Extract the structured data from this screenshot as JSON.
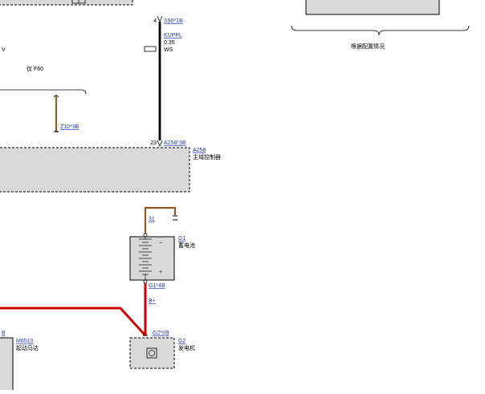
{
  "colors": {
    "wire_black": "#000000",
    "wire_red": "#cc0000",
    "wire_brown": "#8b5a2b",
    "box_fill": "#d9d9d9",
    "link": "#1f3fb0"
  },
  "top": {
    "pin_number": "4",
    "connector": "S50*1B",
    "wire_id": "KUPPL",
    "wire_gauge": "0.35",
    "wire_color": "WS",
    "left_edge_letter": "V",
    "variant_note": "仅 F60",
    "left_connector": "Z10*3B"
  },
  "right_box": {
    "caption": "根据配置情况"
  },
  "a258": {
    "pin_number": "23",
    "connector": "A258*3B",
    "id": "A258",
    "name": "主域控制器"
  },
  "battery": {
    "ground_wire": "31",
    "id": "G1",
    "name": "蓄电池",
    "minus": "−",
    "plus": "+",
    "connector": "G1*4B",
    "wire": "B+"
  },
  "generator": {
    "connector": "G2*2B",
    "id": "G2",
    "name": "发电机"
  },
  "starter": {
    "left_edge_label": "B",
    "id": "M6510",
    "name": "起动马达"
  }
}
